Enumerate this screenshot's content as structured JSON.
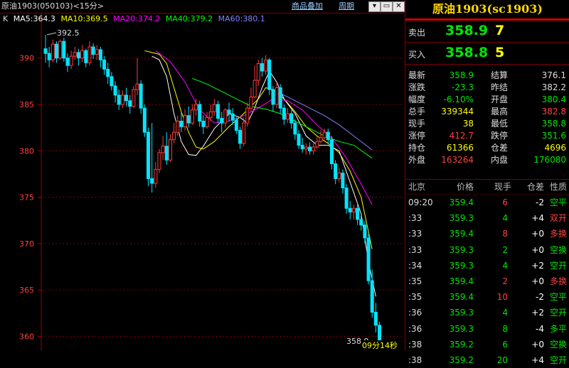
{
  "header": {
    "title": "原油1903(050103)<15分>",
    "add_product": "商品叠加",
    "period": "周期",
    "win_buttons": [
      "▾",
      "▭",
      "✕"
    ]
  },
  "legend": {
    "prefix": "K",
    "ma5": "MA5:364.3",
    "ma10": "MA10:369.5",
    "ma20": "MA20:374.2",
    "ma40": "MA40:379.2",
    "ma60": "MA60:380.1"
  },
  "colors": {
    "up": "#ff3b3b",
    "down": "#00e5ff",
    "ma5": "#ffffff",
    "ma10": "#ffff00",
    "ma20": "#ff00ff",
    "ma40": "#00ff00",
    "ma60": "#8080ff",
    "grid": "#800000"
  },
  "chart_data": {
    "type": "candlestick",
    "ylim": [
      358.5,
      393.5
    ],
    "y_ticks": [
      "390",
      "385",
      "380",
      "375",
      "370",
      "365",
      "360"
    ],
    "high_marker": "392.5",
    "last_price_marker": "358.9",
    "countdown": "09分14秒",
    "candles": [
      [
        391.0,
        390.5,
        392.5,
        389.5
      ],
      [
        390.5,
        389.8,
        391.2,
        389.0
      ],
      [
        389.8,
        391.5,
        392.0,
        389.5
      ],
      [
        391.5,
        390.0,
        391.8,
        389.5
      ],
      [
        390.0,
        391.8,
        392.0,
        389.8
      ],
      [
        391.8,
        390.0,
        392.2,
        389.6
      ],
      [
        390.0,
        389.2,
        390.5,
        388.5
      ],
      [
        389.2,
        390.2,
        390.8,
        388.8
      ],
      [
        390.2,
        390.6,
        391.2,
        389.8
      ],
      [
        390.6,
        390.0,
        391.0,
        389.2
      ],
      [
        390.0,
        390.8,
        391.4,
        389.6
      ],
      [
        390.8,
        389.5,
        391.0,
        389.0
      ],
      [
        389.5,
        391.2,
        391.8,
        389.2
      ],
      [
        391.2,
        390.4,
        391.6,
        389.9
      ],
      [
        390.4,
        390.9,
        391.4,
        389.8
      ],
      [
        390.9,
        389.8,
        391.2,
        389.0
      ],
      [
        389.8,
        388.8,
        390.2,
        388.2
      ],
      [
        388.8,
        388.0,
        389.5,
        387.2
      ],
      [
        388.0,
        387.0,
        388.5,
        386.5
      ],
      [
        387.0,
        386.0,
        387.5,
        385.2
      ],
      [
        386.0,
        385.0,
        386.6,
        384.4
      ],
      [
        385.0,
        386.0,
        386.5,
        384.6
      ],
      [
        386.0,
        385.4,
        386.8,
        384.8
      ],
      [
        385.4,
        384.8,
        386.0,
        384.0
      ],
      [
        384.8,
        386.6,
        387.0,
        384.6
      ],
      [
        386.6,
        387.2,
        390.0,
        386.0
      ],
      [
        387.2,
        384.6,
        387.6,
        384.0
      ],
      [
        384.6,
        382.0,
        385.0,
        381.5
      ],
      [
        382.0,
        377.0,
        382.5,
        376.2
      ],
      [
        377.0,
        376.5,
        383.0,
        375.5
      ],
      [
        376.5,
        378.0,
        378.8,
        376.0
      ],
      [
        378.0,
        379.8,
        380.2,
        377.6
      ],
      [
        379.8,
        380.5,
        381.6,
        379.0
      ],
      [
        380.5,
        379.0,
        382.0,
        378.5
      ],
      [
        379.0,
        381.2,
        381.8,
        378.8
      ],
      [
        381.2,
        382.0,
        383.0,
        380.8
      ],
      [
        382.0,
        383.2,
        383.8,
        381.6
      ],
      [
        383.2,
        382.6,
        384.2,
        382.0
      ],
      [
        382.6,
        383.8,
        384.5,
        382.2
      ],
      [
        383.8,
        383.0,
        384.8,
        382.5
      ],
      [
        383.0,
        384.4,
        385.0,
        382.8
      ],
      [
        384.4,
        385.0,
        385.6,
        383.8
      ],
      [
        385.0,
        383.2,
        385.4,
        382.6
      ],
      [
        383.2,
        382.6,
        383.8,
        381.8
      ],
      [
        382.6,
        383.6,
        384.2,
        382.4
      ],
      [
        383.6,
        384.2,
        385.0,
        383.2
      ],
      [
        384.2,
        385.0,
        385.6,
        383.8
      ],
      [
        385.0,
        383.5,
        385.4,
        383.0
      ],
      [
        383.5,
        383.0,
        384.2,
        382.0
      ],
      [
        383.0,
        384.4,
        384.6,
        382.5
      ],
      [
        384.4,
        384.0,
        385.2,
        383.2
      ],
      [
        384.0,
        383.3,
        384.6,
        382.8
      ],
      [
        383.3,
        382.2,
        383.6,
        381.8
      ],
      [
        382.2,
        380.8,
        382.6,
        380.2
      ],
      [
        380.8,
        383.0,
        383.6,
        380.5
      ],
      [
        383.0,
        384.6,
        385.2,
        382.6
      ],
      [
        384.6,
        385.8,
        386.8,
        384.2
      ],
      [
        385.8,
        387.6,
        389.2,
        385.6
      ],
      [
        387.6,
        389.4,
        389.8,
        387.0
      ],
      [
        389.4,
        388.6,
        390.0,
        388.0
      ],
      [
        388.6,
        389.8,
        390.3,
        388.2
      ],
      [
        389.8,
        386.6,
        390.0,
        386.0
      ],
      [
        386.6,
        385.0,
        387.0,
        384.2
      ],
      [
        385.0,
        386.8,
        387.4,
        384.6
      ],
      [
        386.8,
        384.6,
        387.2,
        384.0
      ],
      [
        384.6,
        383.4,
        385.0,
        382.8
      ],
      [
        383.4,
        384.0,
        384.6,
        383.0
      ],
      [
        384.0,
        383.0,
        384.4,
        382.4
      ],
      [
        383.0,
        381.8,
        383.4,
        381.2
      ],
      [
        381.8,
        380.6,
        382.2,
        380.2
      ],
      [
        380.6,
        380.2,
        381.4,
        379.8
      ],
      [
        380.2,
        380.4,
        380.8,
        379.6
      ],
      [
        380.4,
        380.0,
        380.9,
        379.6
      ],
      [
        380.0,
        380.4,
        380.8,
        379.6
      ],
      [
        380.4,
        381.0,
        381.6,
        380.2
      ],
      [
        381.0,
        381.4,
        382.2,
        380.8
      ],
      [
        381.4,
        382.0,
        382.4,
        381.2
      ],
      [
        382.0,
        381.2,
        382.4,
        380.8
      ],
      [
        381.2,
        378.6,
        381.6,
        378.0
      ],
      [
        378.6,
        377.0,
        379.0,
        376.4
      ],
      [
        377.0,
        377.6,
        378.2,
        376.6
      ],
      [
        377.6,
        376.0,
        378.0,
        375.4
      ],
      [
        376.0,
        373.8,
        376.4,
        373.2
      ],
      [
        373.8,
        373.4,
        374.6,
        372.6
      ],
      [
        373.4,
        373.8,
        374.2,
        372.6
      ],
      [
        373.8,
        372.6,
        374.4,
        372.0
      ],
      [
        372.6,
        372.0,
        373.0,
        371.4
      ],
      [
        372.0,
        370.6,
        372.4,
        370.0
      ],
      [
        370.6,
        366.0,
        371.0,
        365.6
      ],
      [
        366.0,
        362.6,
        367.2,
        362.0
      ],
      [
        362.6,
        361.2,
        363.6,
        360.4
      ],
      [
        361.2,
        358.9,
        361.6,
        358.6
      ]
    ],
    "ma_series": [
      {
        "key": "ma10",
        "points": [
          [
            27,
            390.8
          ],
          [
            29,
            390.6
          ],
          [
            31,
            390.4
          ],
          [
            33,
            389.4
          ],
          [
            35,
            386.8
          ],
          [
            37,
            384.2
          ],
          [
            39,
            382.0
          ],
          [
            41,
            380.4
          ],
          [
            43,
            380.2
          ],
          [
            46,
            381.0
          ],
          [
            50,
            382.6
          ],
          [
            54,
            384.0
          ],
          [
            58,
            385.6
          ],
          [
            60,
            386.8
          ],
          [
            62,
            386.6
          ],
          [
            65,
            385.6
          ],
          [
            68,
            384.2
          ],
          [
            71,
            382.6
          ],
          [
            74,
            381.6
          ],
          [
            77,
            380.8
          ],
          [
            80,
            379.8
          ],
          [
            83,
            377.8
          ],
          [
            86,
            375.0
          ],
          [
            89,
            369.4
          ]
        ]
      },
      {
        "key": "ma5",
        "points": [
          [
            29,
            390.2
          ],
          [
            31,
            389.8
          ],
          [
            33,
            388.0
          ],
          [
            35,
            384.0
          ],
          [
            37,
            381.0
          ],
          [
            39,
            379.6
          ],
          [
            41,
            379.5
          ],
          [
            43,
            380.5
          ],
          [
            46,
            382.4
          ],
          [
            50,
            384.0
          ],
          [
            53,
            383.6
          ],
          [
            55,
            383.0
          ],
          [
            57,
            384.6
          ],
          [
            59,
            386.8
          ],
          [
            61,
            388.6
          ],
          [
            63,
            387.4
          ],
          [
            65,
            385.6
          ],
          [
            68,
            384.0
          ],
          [
            71,
            381.6
          ],
          [
            74,
            380.6
          ],
          [
            77,
            380.6
          ],
          [
            80,
            380.0
          ],
          [
            83,
            376.6
          ],
          [
            86,
            373.2
          ],
          [
            88,
            368.0
          ],
          [
            90,
            364.3
          ]
        ]
      },
      {
        "key": "ma20",
        "points": [
          [
            30,
            390.8
          ],
          [
            34,
            389.6
          ],
          [
            38,
            387.4
          ],
          [
            42,
            384.4
          ],
          [
            46,
            383.0
          ],
          [
            50,
            383.2
          ],
          [
            54,
            383.8
          ],
          [
            58,
            384.6
          ],
          [
            62,
            385.6
          ],
          [
            66,
            385.4
          ],
          [
            70,
            384.4
          ],
          [
            74,
            382.8
          ],
          [
            78,
            381.4
          ],
          [
            82,
            379.2
          ],
          [
            86,
            376.4
          ],
          [
            89,
            374.2
          ]
        ]
      },
      {
        "key": "ma40",
        "points": [
          [
            40,
            387.8
          ],
          [
            44,
            387.2
          ],
          [
            48,
            386.4
          ],
          [
            52,
            385.6
          ],
          [
            56,
            384.8
          ],
          [
            60,
            384.5
          ],
          [
            64,
            384.0
          ],
          [
            68,
            383.2
          ],
          [
            72,
            382.4
          ],
          [
            76,
            381.6
          ],
          [
            80,
            381.0
          ],
          [
            84,
            380.6
          ],
          [
            89,
            379.2
          ]
        ]
      },
      {
        "key": "ma60",
        "points": [
          [
            64,
            386.2
          ],
          [
            68,
            385.4
          ],
          [
            72,
            384.6
          ],
          [
            76,
            383.8
          ],
          [
            80,
            382.8
          ],
          [
            84,
            381.6
          ],
          [
            89,
            380.1
          ]
        ]
      }
    ]
  },
  "quote": {
    "title": "原油1903(sc1903)",
    "ask": {
      "label": "卖出",
      "price": "358.9",
      "vol": "7"
    },
    "bid": {
      "label": "买入",
      "price": "358.8",
      "vol": "5"
    },
    "stats": [
      {
        "l": "最新",
        "v": "358.9",
        "vc": "#00e600",
        "l2": "结算",
        "v2": "376.1",
        "vc2": "#ddd"
      },
      {
        "l": "涨跌",
        "v": "-23.3",
        "vc": "#00e600",
        "l2": "昨结",
        "v2": "382.2",
        "vc2": "#ddd"
      },
      {
        "l": "幅度",
        "v": "-6.10%",
        "vc": "#00e600",
        "l2": "开盘",
        "v2": "380.4",
        "vc2": "#00e600"
      },
      {
        "l": "总手",
        "v": "339344",
        "vc": "#ffff00",
        "l2": "最高",
        "v2": "382.8",
        "vc2": "#ff4040"
      },
      {
        "l": "现手",
        "v": "38",
        "vc": "#ffff00",
        "l2": "最低",
        "v2": "358.8",
        "vc2": "#00e600"
      },
      {
        "l": "涨停",
        "v": "412.7",
        "vc": "#ff4040",
        "l2": "跌停",
        "v2": "351.6",
        "vc2": "#00e600"
      },
      {
        "l": "持仓",
        "v": "61366",
        "vc": "#ffff00",
        "l2": "仓差",
        "v2": "4696",
        "vc2": "#ffff00"
      },
      {
        "l": "外盘",
        "v": "163264",
        "vc": "#ff4040",
        "l2": "内盘",
        "v2": "176080",
        "vc2": "#00e600"
      }
    ],
    "ticks_header": {
      "time": "北京",
      "price": "价格",
      "qty": "现手",
      "oi": "仓差",
      "nature": "性质"
    },
    "ticks": [
      {
        "t": "09:20",
        "p": "359.4",
        "q": "6",
        "qc": "#ff4040",
        "o": "-2",
        "n": "空平",
        "nc": "#00e600"
      },
      {
        "t": ":33",
        "p": "359.3",
        "q": "4",
        "qc": "#00e600",
        "o": "+4",
        "n": "双开",
        "nc": "#ff4040"
      },
      {
        "t": ":33",
        "p": "359.4",
        "q": "8",
        "qc": "#ff4040",
        "o": "+0",
        "n": "多换",
        "nc": "#ff4040"
      },
      {
        "t": ":33",
        "p": "359.3",
        "q": "2",
        "qc": "#00e600",
        "o": "+0",
        "n": "空换",
        "nc": "#00e600"
      },
      {
        "t": ":34",
        "p": "359.3",
        "q": "4",
        "qc": "#00e600",
        "o": "+2",
        "n": "空开",
        "nc": "#00e600"
      },
      {
        "t": ":35",
        "p": "359.4",
        "q": "2",
        "qc": "#ff4040",
        "o": "+0",
        "n": "多换",
        "nc": "#ff4040"
      },
      {
        "t": ":35",
        "p": "359.4",
        "q": "10",
        "qc": "#ff4040",
        "o": "-2",
        "n": "空平",
        "nc": "#00e600"
      },
      {
        "t": ":36",
        "p": "359.3",
        "q": "4",
        "qc": "#00e600",
        "o": "+2",
        "n": "空开",
        "nc": "#00e600"
      },
      {
        "t": ":36",
        "p": "359.3",
        "q": "8",
        "qc": "#00e600",
        "o": "-4",
        "n": "多平",
        "nc": "#00e600"
      },
      {
        "t": ":38",
        "p": "359.2",
        "q": "6",
        "qc": "#00e600",
        "o": "+0",
        "n": "空换",
        "nc": "#00e600"
      },
      {
        "t": ":38",
        "p": "359.2",
        "q": "20",
        "qc": "#00e600",
        "o": "+4",
        "n": "空开",
        "nc": "#00e600"
      }
    ]
  }
}
